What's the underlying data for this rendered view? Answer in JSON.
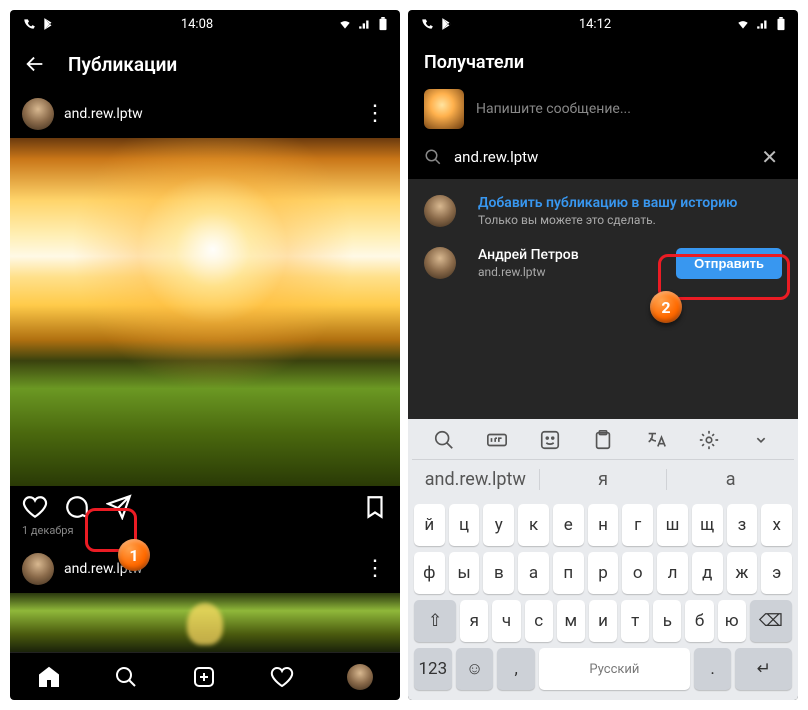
{
  "left": {
    "status_time": "14:08",
    "header_title": "Публикации",
    "post_user": "and.rew.lptw",
    "post_date": "1 декабря",
    "second_post_user": "and.rew.lptw"
  },
  "right": {
    "status_time": "14:12",
    "header_title": "Получатели",
    "compose_placeholder": "Напишите сообщение...",
    "search_value": "and.rew.lptw",
    "story_row": {
      "title": "Добавить публикацию в вашу историю",
      "subtitle": "Только вы можете это сделать."
    },
    "user_row": {
      "name": "Андрей Петров",
      "handle": "and.rew.lptw",
      "button": "Отправить"
    },
    "keyboard": {
      "suggest": [
        "and.rew.lptw",
        "я",
        "а"
      ],
      "row1": [
        "й",
        "ц",
        "у",
        "к",
        "е",
        "н",
        "г",
        "ш",
        "щ",
        "з",
        "х"
      ],
      "row2": [
        "ф",
        "ы",
        "в",
        "а",
        "п",
        "р",
        "о",
        "л",
        "д",
        "ж",
        "э"
      ],
      "row3_shift": "⇧",
      "row3": [
        "я",
        "ч",
        "с",
        "м",
        "и",
        "т",
        "ь",
        "б",
        "ю"
      ],
      "row3_bksp": "⌫",
      "bottom": {
        "num": "123",
        "space": "Русский",
        "enter": "↵"
      }
    }
  },
  "callouts": {
    "one": "1",
    "two": "2"
  }
}
